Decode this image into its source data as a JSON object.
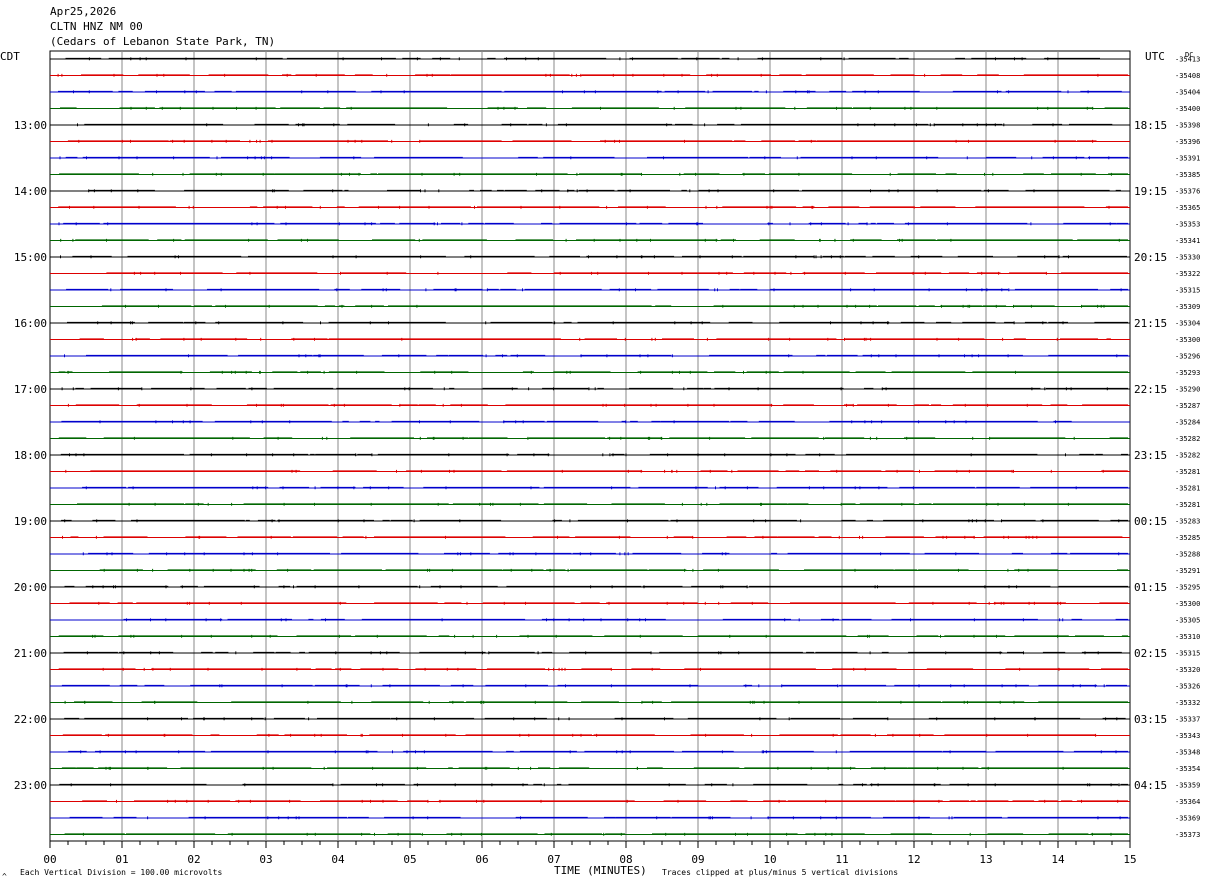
{
  "header": {
    "date": "Apr25,2026",
    "station": "CLTN HNZ NM 00",
    "location": "(Cedars of Lebanon State Park, TN)",
    "left_tz": "CDT",
    "right_tz": "UTC",
    "dc_label": "DC"
  },
  "footer": {
    "scale_note": "Each Vertical Division =  100.00 microvolts",
    "xlabel": "TIME (MINUTES)",
    "clip_note": "Traces clipped at plus/minus 5 vertical divisions",
    "corner_mark": "^"
  },
  "colors": {
    "trace_cycle": [
      "#000000",
      "#dd0000",
      "#0000cc",
      "#006600"
    ],
    "grid": "#888888",
    "frame": "#000000"
  },
  "chart_data": {
    "type": "line",
    "title": "CLTN HNZ NM 00",
    "xlabel": "TIME (MINUTES)",
    "xlim": [
      0,
      15
    ],
    "x_ticks": [
      "00",
      "01",
      "02",
      "03",
      "04",
      "05",
      "06",
      "07",
      "08",
      "09",
      "10",
      "11",
      "12",
      "13",
      "14",
      "15"
    ],
    "row_minutes": 15,
    "left_hour_labels": [
      "13:00",
      "14:00",
      "15:00",
      "16:00",
      "17:00",
      "18:00",
      "19:00",
      "20:00",
      "21:00",
      "22:00",
      "23:00"
    ],
    "right_hour_labels": [
      "18:15",
      "19:15",
      "20:15",
      "21:15",
      "22:15",
      "23:15",
      "00:15",
      "01:15",
      "02:15",
      "03:15",
      "04:15"
    ],
    "hour_label_first_row": 4,
    "hour_label_every_rows": 4,
    "dc_offsets": [
      "-35413",
      "-35408",
      "-35404",
      "-35400",
      "-35398",
      "-35396",
      "-35391",
      "-35385",
      "-35376",
      "-35365",
      "-35353",
      "-35341",
      "-35330",
      "-35322",
      "-35315",
      "-35309",
      "-35304",
      "-35300",
      "-35296",
      "-35293",
      "-35290",
      "-35287",
      "-35284",
      "-35282",
      "-35282",
      "-35281",
      "-35281",
      "-35281",
      "-35283",
      "-35285",
      "-35288",
      "-35291",
      "-35295",
      "-35300",
      "-35305",
      "-35310",
      "-35315",
      "-35320",
      "-35326",
      "-35332",
      "-35337",
      "-35343",
      "-35348",
      "-35354",
      "-35359",
      "-35364",
      "-35369",
      "-35373"
    ]
  }
}
